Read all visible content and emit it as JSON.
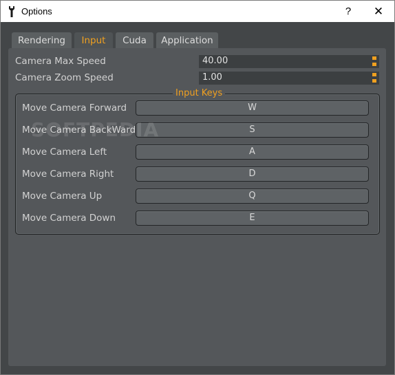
{
  "window": {
    "title": "Options",
    "help_label": "?",
    "close_label": "✕"
  },
  "tabs": [
    {
      "label": "Rendering",
      "active": false
    },
    {
      "label": "Input",
      "active": true
    },
    {
      "label": "Cuda",
      "active": false
    },
    {
      "label": "Application",
      "active": false
    }
  ],
  "settings": [
    {
      "label": "Camera Max Speed",
      "value": "40.00"
    },
    {
      "label": "Camera Zoom Speed",
      "value": "1.00"
    }
  ],
  "input_keys": {
    "title": "Input Keys",
    "bindings": [
      {
        "label": "Move Camera Forward",
        "key": "W"
      },
      {
        "label": "Move Camera BackWard",
        "key": "S"
      },
      {
        "label": "Move Camera Left",
        "key": "A"
      },
      {
        "label": "Move Camera Right",
        "key": "D"
      },
      {
        "label": "Move Camera Up",
        "key": "Q"
      },
      {
        "label": "Move Camera Down",
        "key": "E"
      }
    ]
  },
  "watermark": "SOFTPEDIA",
  "colors": {
    "accent": "#f0a020",
    "panel": "#54575a",
    "background": "#434648"
  }
}
